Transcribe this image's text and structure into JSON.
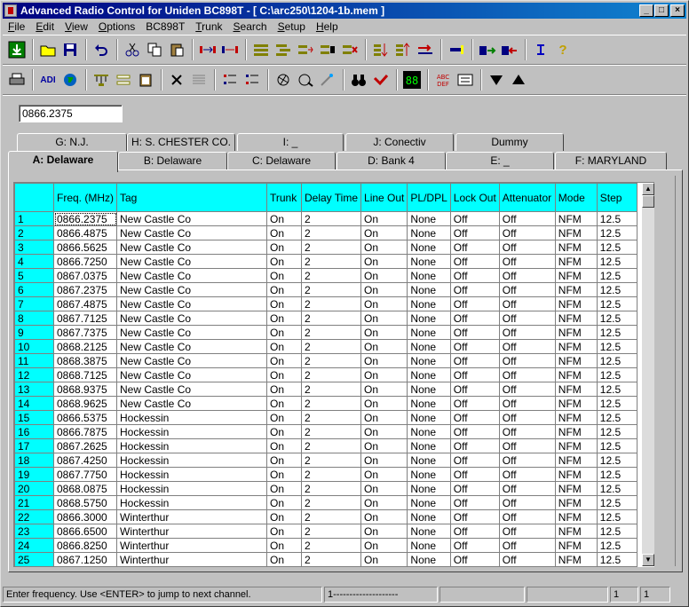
{
  "window": {
    "title": "Advanced Radio Control for Uniden BC898T - [ C:\\arc250\\1204-1b.mem ]"
  },
  "menu": [
    {
      "name": "file",
      "label": "File",
      "u": "F",
      "rest": "ile"
    },
    {
      "name": "edit",
      "label": "Edit",
      "u": "E",
      "rest": "dit"
    },
    {
      "name": "view",
      "label": "View",
      "u": "V",
      "rest": "iew"
    },
    {
      "name": "options",
      "label": "Options",
      "u": "O",
      "rest": "ptions"
    },
    {
      "name": "bc898t",
      "label": "BC898T",
      "u": "",
      "rest": "BC898T"
    },
    {
      "name": "trunk",
      "label": "Trunk",
      "u": "T",
      "rest": "runk"
    },
    {
      "name": "search",
      "label": "Search",
      "u": "S",
      "rest": "earch"
    },
    {
      "name": "setup",
      "label": "Setup",
      "u": "S",
      "rest": "etup"
    },
    {
      "name": "help",
      "label": "Help",
      "u": "H",
      "rest": "elp"
    }
  ],
  "frequency_input": {
    "value": "0866.2375"
  },
  "tabs_back": [
    {
      "label": "G: N.J."
    },
    {
      "label": "H: S. CHESTER CO."
    },
    {
      "label": "I: _"
    },
    {
      "label": "J: Conectiv"
    },
    {
      "label": "Dummy"
    }
  ],
  "tabs_front": [
    {
      "label": "A: Delaware",
      "active": true
    },
    {
      "label": "B: Delaware"
    },
    {
      "label": "C: Delaware"
    },
    {
      "label": "D: Bank 4"
    },
    {
      "label": "E: _"
    },
    {
      "label": "F: MARYLAND"
    }
  ],
  "columns": [
    "",
    "Freq. (MHz)",
    "Tag",
    "Trunk",
    "Delay Time",
    "Line Out",
    "PL/DPL",
    "Lock Out",
    "Attenuator",
    "Mode",
    "Step"
  ],
  "rows": [
    [
      "1",
      "0866.2375",
      "New Castle Co",
      "On",
      "2",
      "On",
      "None",
      "Off",
      "Off",
      "NFM",
      "12.5"
    ],
    [
      "2",
      "0866.4875",
      "New Castle Co",
      "On",
      "2",
      "On",
      "None",
      "Off",
      "Off",
      "NFM",
      "12.5"
    ],
    [
      "3",
      "0866.5625",
      "New Castle Co",
      "On",
      "2",
      "On",
      "None",
      "Off",
      "Off",
      "NFM",
      "12.5"
    ],
    [
      "4",
      "0866.7250",
      "New Castle Co",
      "On",
      "2",
      "On",
      "None",
      "Off",
      "Off",
      "NFM",
      "12.5"
    ],
    [
      "5",
      "0867.0375",
      "New Castle Co",
      "On",
      "2",
      "On",
      "None",
      "Off",
      "Off",
      "NFM",
      "12.5"
    ],
    [
      "6",
      "0867.2375",
      "New Castle Co",
      "On",
      "2",
      "On",
      "None",
      "Off",
      "Off",
      "NFM",
      "12.5"
    ],
    [
      "7",
      "0867.4875",
      "New Castle Co",
      "On",
      "2",
      "On",
      "None",
      "Off",
      "Off",
      "NFM",
      "12.5"
    ],
    [
      "8",
      "0867.7125",
      "New Castle Co",
      "On",
      "2",
      "On",
      "None",
      "Off",
      "Off",
      "NFM",
      "12.5"
    ],
    [
      "9",
      "0867.7375",
      "New Castle Co",
      "On",
      "2",
      "On",
      "None",
      "Off",
      "Off",
      "NFM",
      "12.5"
    ],
    [
      "10",
      "0868.2125",
      "New Castle Co",
      "On",
      "2",
      "On",
      "None",
      "Off",
      "Off",
      "NFM",
      "12.5"
    ],
    [
      "11",
      "0868.3875",
      "New Castle Co",
      "On",
      "2",
      "On",
      "None",
      "Off",
      "Off",
      "NFM",
      "12.5"
    ],
    [
      "12",
      "0868.7125",
      "New Castle Co",
      "On",
      "2",
      "On",
      "None",
      "Off",
      "Off",
      "NFM",
      "12.5"
    ],
    [
      "13",
      "0868.9375",
      "New Castle Co",
      "On",
      "2",
      "On",
      "None",
      "Off",
      "Off",
      "NFM",
      "12.5"
    ],
    [
      "14",
      "0868.9625",
      "New Castle Co",
      "On",
      "2",
      "On",
      "None",
      "Off",
      "Off",
      "NFM",
      "12.5"
    ],
    [
      "15",
      "0866.5375",
      "Hockessin",
      "On",
      "2",
      "On",
      "None",
      "Off",
      "Off",
      "NFM",
      "12.5"
    ],
    [
      "16",
      "0866.7875",
      "Hockessin",
      "On",
      "2",
      "On",
      "None",
      "Off",
      "Off",
      "NFM",
      "12.5"
    ],
    [
      "17",
      "0867.2625",
      "Hockessin",
      "On",
      "2",
      "On",
      "None",
      "Off",
      "Off",
      "NFM",
      "12.5"
    ],
    [
      "18",
      "0867.4250",
      "Hockessin",
      "On",
      "2",
      "On",
      "None",
      "Off",
      "Off",
      "NFM",
      "12.5"
    ],
    [
      "19",
      "0867.7750",
      "Hockessin",
      "On",
      "2",
      "On",
      "None",
      "Off",
      "Off",
      "NFM",
      "12.5"
    ],
    [
      "20",
      "0868.0875",
      "Hockessin",
      "On",
      "2",
      "On",
      "None",
      "Off",
      "Off",
      "NFM",
      "12.5"
    ],
    [
      "21",
      "0868.5750",
      "Hockessin",
      "On",
      "2",
      "On",
      "None",
      "Off",
      "Off",
      "NFM",
      "12.5"
    ],
    [
      "22",
      "0866.3000",
      "Winterthur",
      "On",
      "2",
      "On",
      "None",
      "Off",
      "Off",
      "NFM",
      "12.5"
    ],
    [
      "23",
      "0866.6500",
      "Winterthur",
      "On",
      "2",
      "On",
      "None",
      "Off",
      "Off",
      "NFM",
      "12.5"
    ],
    [
      "24",
      "0866.8250",
      "Winterthur",
      "On",
      "2",
      "On",
      "None",
      "Off",
      "Off",
      "NFM",
      "12.5"
    ],
    [
      "25",
      "0867.1250",
      "Winterthur",
      "On",
      "2",
      "On",
      "None",
      "Off",
      "Off",
      "NFM",
      "12.5"
    ]
  ],
  "status": {
    "message": "Enter frequency. Use <ENTER> to jump to next channel.",
    "range": "1--------------------",
    "pane3": "",
    "pane4": "",
    "row": "1",
    "col": "1"
  },
  "colors": {
    "grid_header": "#00ffff",
    "title_start": "#000080",
    "title_end": "#1084d0"
  }
}
